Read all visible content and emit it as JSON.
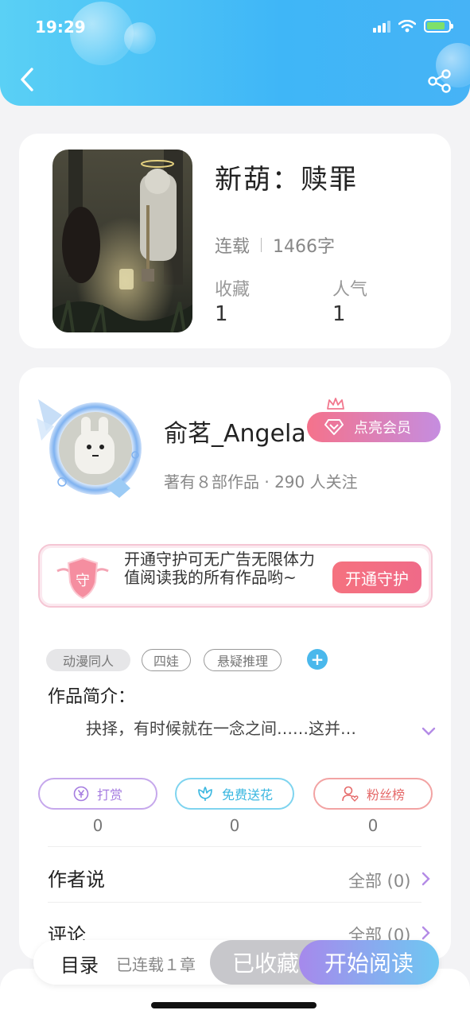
{
  "status_bar": {
    "time": "19:29"
  },
  "book": {
    "title": "新葫：赎罪",
    "status": "连载",
    "word_count": "1466字",
    "favorites_label": "收藏",
    "favorites_value": "1",
    "popularity_label": "人气",
    "popularity_value": "1"
  },
  "author": {
    "name": "俞茗_Angela",
    "vip_label": "点亮会员",
    "stats": "著有８部作品 · 290 人关注"
  },
  "guard": {
    "text": "开通守护可无广告无限体力值阅读我的所有作品哟~",
    "badge": "守",
    "button_label": "开通守护"
  },
  "tags": [
    "动漫同人",
    "四娃",
    "悬疑推理"
  ],
  "intro": {
    "title": "作品简介：",
    "text": "抉择，有时候就在一念之间……这并…"
  },
  "actions": [
    {
      "label": "打赏",
      "icon": "yen-coin-icon",
      "count": "0",
      "color": "#b48be6"
    },
    {
      "label": "免费送花",
      "icon": "flower-icon",
      "count": "0",
      "color": "#46c3e8"
    },
    {
      "label": "粉丝榜",
      "icon": "fan-user-icon",
      "count": "0",
      "color": "#ef7a7a"
    }
  ],
  "rows": [
    {
      "label": "作者说",
      "right": "全部 (0)"
    },
    {
      "label": "评论",
      "right": "全部 (0)"
    }
  ],
  "bottom_bar": {
    "toc_label": "目录",
    "toc_count": "已连载１章",
    "favorite_label": "已收藏",
    "read_label": "开始阅读"
  },
  "colors": {
    "header_gradient_start": "#5ad0f5",
    "header_gradient_end": "#46b3f6",
    "vip_gradient_start": "#f5728b",
    "vip_gradient_end": "#c58de0",
    "read_gradient_start": "#a689ec",
    "read_gradient_end": "#6ec8f2"
  }
}
